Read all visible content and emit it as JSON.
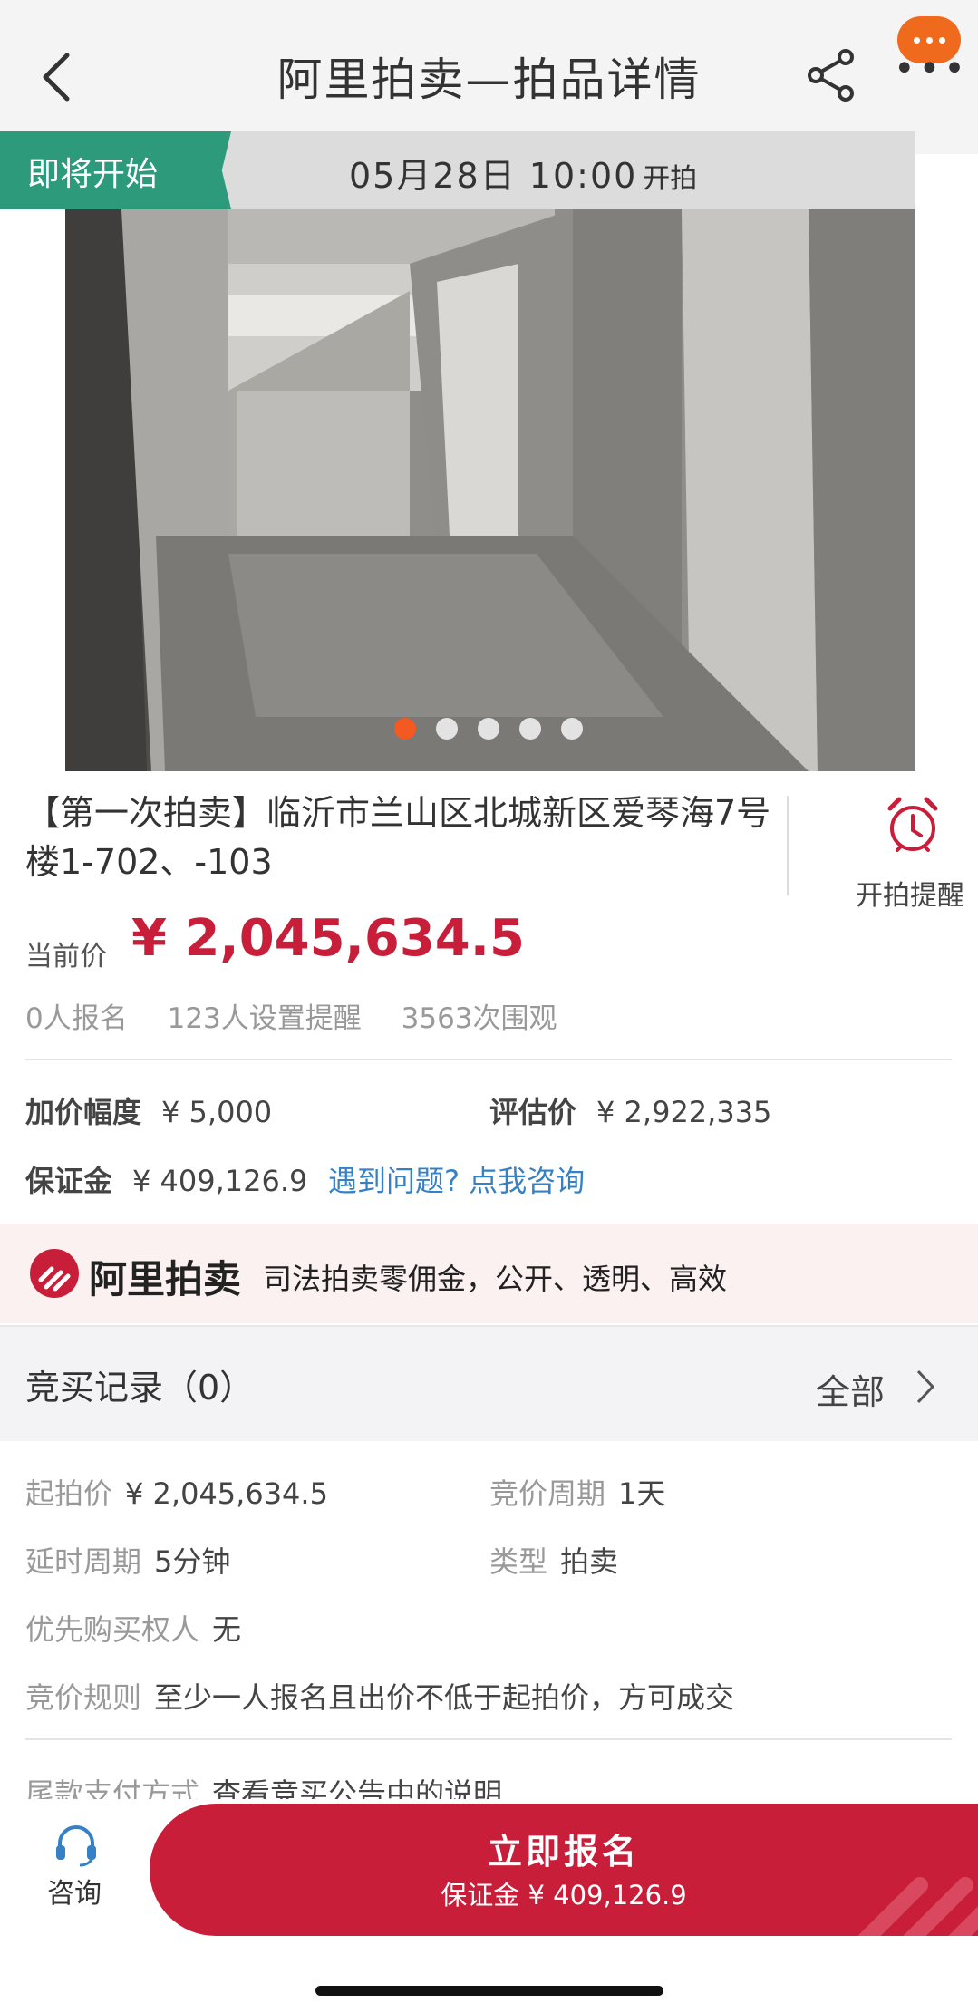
{
  "nav": {
    "title": "阿里拍卖—拍品详情"
  },
  "status": {
    "tag": "即将开始",
    "time": "05月28日 10:00",
    "suffix": "开拍"
  },
  "gallery": {
    "image_count": 5,
    "active_index": 0
  },
  "item": {
    "title": "【第一次拍卖】临沂市兰山区北城新区爱琴海7号楼1-702、-103",
    "reminder_label": "开拍提醒",
    "price_label": "当前价",
    "price": "¥ 2,045,634.5",
    "stats": [
      "0人报名",
      "123人设置提醒",
      "3563次围观"
    ]
  },
  "terms": {
    "increment_label": "加价幅度",
    "increment_value": "¥ 5,000",
    "appraisal_label": "评估价",
    "appraisal_value": "¥ 2,922,335",
    "deposit_label": "保证金",
    "deposit_value": "¥ 409,126.9",
    "help_link": "遇到问题? 点我咨询"
  },
  "banner": {
    "logo": "阿里拍卖",
    "slogan": "司法拍卖零佣金，公开、透明、高效"
  },
  "records": {
    "title": "竞买记录（0）",
    "all": "全部"
  },
  "details": {
    "start_price_label": "起拍价",
    "start_price_value": "¥ 2,045,634.5",
    "cycle_label": "竞价周期",
    "cycle_value": "1天",
    "delay_label": "延时周期",
    "delay_value": "5分钟",
    "type_label": "类型",
    "type_value": "拍卖",
    "priority_label": "优先购买权人",
    "priority_value": "无",
    "rule_label": "竞价规则",
    "rule_value": "至少一人报名且出价不低于起拍价，方可成交",
    "payment_label": "尾款支付方式",
    "payment_value": "查看竞买公告中的说明"
  },
  "bottom": {
    "consult": "咨询",
    "signup": "立即报名",
    "deposit": "保证金 ¥ 409,126.9"
  },
  "colors": {
    "brand_red": "#c81e3a",
    "status_green": "#2d9a7c",
    "link_blue": "#3680c6",
    "dot_active": "#f25a22",
    "badge_orange": "#f06a1e"
  }
}
